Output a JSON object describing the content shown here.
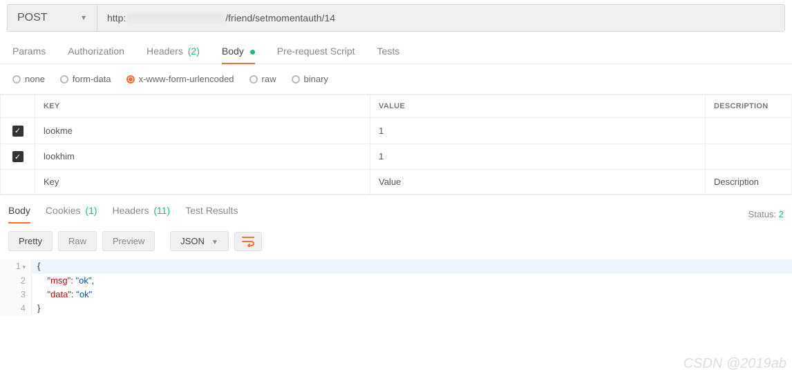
{
  "request": {
    "method": "POST",
    "url_prefix": "http:",
    "url_suffix": "/friend/setmomentauth/14"
  },
  "req_tabs": {
    "params": "Params",
    "auth": "Authorization",
    "headers": "Headers",
    "headers_count": "(2)",
    "body": "Body",
    "prereq": "Pre-request Script",
    "tests": "Tests"
  },
  "body_types": {
    "none": "none",
    "formdata": "form-data",
    "urlenc": "x-www-form-urlencoded",
    "raw": "raw",
    "binary": "binary"
  },
  "kv": {
    "head_key": "KEY",
    "head_val": "VALUE",
    "head_desc": "DESCRIPTION",
    "rows": [
      {
        "key": "lookme",
        "value": "1"
      },
      {
        "key": "lookhim",
        "value": "1"
      }
    ],
    "ph_key": "Key",
    "ph_val": "Value",
    "ph_desc": "Description"
  },
  "resp_tabs": {
    "body": "Body",
    "cookies": "Cookies",
    "cookies_count": "(1)",
    "headers": "Headers",
    "headers_count": "(11)",
    "tests": "Test Results",
    "status_label": "Status:",
    "status_value": "2"
  },
  "view": {
    "pretty": "Pretty",
    "raw": "Raw",
    "preview": "Preview",
    "lang": "JSON"
  },
  "response_body": {
    "l1": "{",
    "l2_key": "\"msg\"",
    "l2_sep": ": ",
    "l2_val": "\"ok\"",
    "l2_tail": ",",
    "l3_key": "\"data\"",
    "l3_sep": ": ",
    "l3_val": "\"ok\"",
    "l4": "}",
    "ln1": "1",
    "ln2": "2",
    "ln3": "3",
    "ln4": "4"
  },
  "watermark": "CSDN @2019ab"
}
